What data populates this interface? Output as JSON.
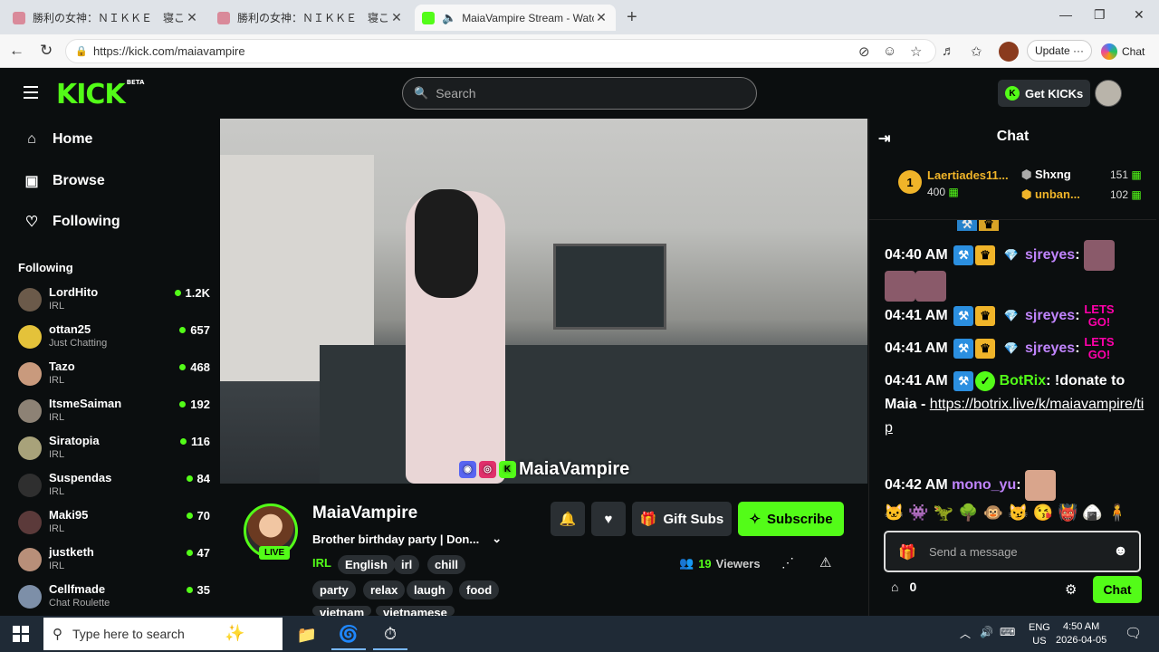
{
  "browser": {
    "tabs": [
      {
        "title": "勝利の女神：ＮＩＫＫＥ　寝ころび",
        "active": false
      },
      {
        "title": "勝利の女神：ＮＩＫＫＥ　寝ころび",
        "active": false
      },
      {
        "title": "MaiaVampire Stream - Watch",
        "active": true
      }
    ],
    "url": "https://kick.com/maiavampire",
    "update_label": "Update",
    "chat_label": "Chat"
  },
  "kick": {
    "logo": "KICK",
    "beta": "BETA",
    "search_placeholder": "Search",
    "get_kicks": "Get KICKs"
  },
  "sidebar": {
    "nav": [
      {
        "label": "Home",
        "icon": "home-icon"
      },
      {
        "label": "Browse",
        "icon": "browse-icon"
      },
      {
        "label": "Following",
        "icon": "heart-icon"
      }
    ],
    "following_header": "Following",
    "following": [
      {
        "name": "LordHito",
        "category": "IRL",
        "viewers": "1.2K",
        "color": "#6b5a4a"
      },
      {
        "name": "ottan25",
        "category": "Just Chatting",
        "viewers": "657",
        "color": "#e4c23a"
      },
      {
        "name": "Tazo",
        "category": "IRL",
        "viewers": "468",
        "color": "#c99a7d"
      },
      {
        "name": "ItsmeSaiman",
        "category": "IRL",
        "viewers": "192",
        "color": "#8d8275"
      },
      {
        "name": "Siratopia",
        "category": "IRL",
        "viewers": "116",
        "color": "#a8a27a"
      },
      {
        "name": "Suspendas",
        "category": "IRL",
        "viewers": "84",
        "color": "#2f2f2f"
      },
      {
        "name": "Maki95",
        "category": "IRL",
        "viewers": "70",
        "color": "#5b3a3a"
      },
      {
        "name": "justketh",
        "category": "IRL",
        "viewers": "47",
        "color": "#b88f79"
      },
      {
        "name": "Cellfmade",
        "category": "Chat Roulette",
        "viewers": "35",
        "color": "#7d8fa8"
      }
    ]
  },
  "stream": {
    "watermark": "MaiaVampire",
    "channel": "MaiaVampire",
    "live": "LIVE",
    "title": "Brother birthday party | Don...",
    "category": "IRL",
    "tags_row1": [
      "English",
      "irl",
      "chill"
    ],
    "tags_row2": [
      "party",
      "relax",
      "laugh",
      "food"
    ],
    "tags_row3": [
      "vietnam",
      "vietnamese"
    ],
    "gift_subs": "Gift Subs",
    "subscribe": "Subscribe",
    "viewer_count": "19",
    "viewers_label": "Viewers"
  },
  "chat": {
    "header": "Chat",
    "leaderboard": {
      "rank": "1",
      "first_name": "Laertiades11...",
      "first_amount": "400",
      "second_name": "Shxng",
      "second_amount": "151",
      "third_name": "unban...",
      "third_amount": "102"
    },
    "messages": [
      {
        "time": "04:40 AM",
        "user": "sjreyes",
        "text": ""
      },
      {
        "time": "04:41 AM",
        "user": "sjreyes",
        "text": ""
      },
      {
        "time": "04:41 AM",
        "user": "sjreyes",
        "text": ""
      },
      {
        "time": "04:41 AM",
        "user": "BotRix",
        "text": "!donate to Maia - ",
        "link": "https://botrix.live/k/maiavampire/tip"
      },
      {
        "time": "04:42 AM",
        "user": "mono_yu",
        "text": ""
      }
    ],
    "emote_letsgo": "LETS GO!",
    "input_placeholder": "Send a message",
    "kicks_count": "0",
    "chat_button": "Chat"
  },
  "taskbar": {
    "search_placeholder": "Type here to search",
    "lang": "ENG",
    "region": "US",
    "time": "4:50 AM",
    "date": "2026-04-05"
  }
}
